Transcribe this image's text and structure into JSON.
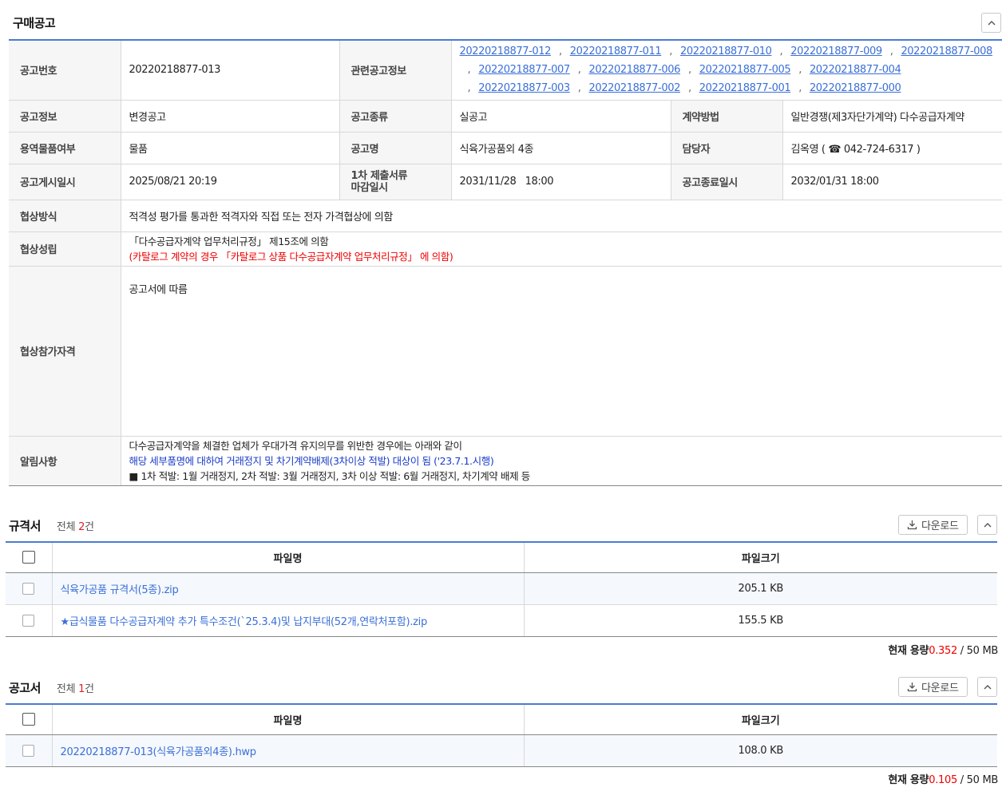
{
  "main": {
    "title": "구매공고",
    "rows": {
      "notice_no_label": "공고번호",
      "notice_no": "20220218877-013",
      "related_label": "관련공고정보",
      "related_links": [
        "20220218877-012",
        "20220218877-011",
        "20220218877-010",
        "20220218877-009",
        "20220218877-008",
        "20220218877-007",
        "20220218877-006",
        "20220218877-005",
        "20220218877-004",
        "20220218877-003",
        "20220218877-002",
        "20220218877-001",
        "20220218877-000"
      ],
      "related_sep": ",",
      "info_label": "공고정보",
      "info_value": "변경공고",
      "kind_label": "공고종류",
      "kind_value": "실공고",
      "contract_label": "계약방법",
      "contract_value": "일반경쟁(제3자단가계약) 다수공급자계약",
      "service_label": "용역물품여부",
      "service_value": "물품",
      "name_label": "공고명",
      "name_value": "식육가공품외 4종",
      "manager_label": "담당자",
      "manager_name": "김옥영 (",
      "manager_phone_icon": "☎",
      "manager_phone": " 042-724-6317 )",
      "posted_label": "공고게시일시",
      "posted_value": "2025/08/21 20:19",
      "deadline_label_1": "1차 제출서류",
      "deadline_label_2": "마감일시",
      "deadline_value": "2031/11/28   18:00",
      "end_label": "공고종료일시",
      "end_value": "2032/01/31 18:00",
      "nego_method_label": "협상방식",
      "nego_method_value": "적격성 평가를 통과한 적격자와 직접 또는 전자 가격협상에 의함",
      "nego_est_label": "협상성립",
      "nego_est_line1": "「다수공급자계약 업무처리규정」 제15조에 의함",
      "nego_est_line2": "(카탈로그 계약의 경우 「카탈로그 상품 다수공급자계약 업무처리규정」 에 의함)",
      "qual_label": "협상참가자격",
      "qual_value": "공고서에 따름",
      "notice_label": "알림사항",
      "notice_line1": "다수공급자계약을 체결한 업체가 우대가격 유지의무를 위반한 경우에는 아래와 같이",
      "notice_line2": "해당 세부품명에 대하여 거래정지 및 차기계약배제(3차이상 적발) 대상이 됨 ('23.7.1.시행)",
      "notice_line3": "■ 1차 적발: 1월 거래정지, 2차 적발: 3월 거래정지, 3차 이상 적발: 6월 거래정지, 차기계약 배제 등"
    }
  },
  "spec": {
    "title": "규격서",
    "count_prefix": "전체 ",
    "count": "2",
    "count_suffix": "건",
    "download_label": "다운로드",
    "col_name": "파일명",
    "col_size": "파일크기",
    "files": [
      {
        "name": "식육가공품 규격서(5종).zip",
        "size": "205.1 KB"
      },
      {
        "name": "★급식물품 다수공급자계약 추가 특수조건(`25.3.4)및 납지부대(52개,연락처포함).zip",
        "size": "155.5 KB"
      }
    ],
    "cap_label": "현재 용량",
    "cap_used": "0.352",
    "cap_total": " / 50 MB"
  },
  "notice_doc": {
    "title": "공고서",
    "count_prefix": "전체 ",
    "count": "1",
    "count_suffix": "건",
    "download_label": "다운로드",
    "col_name": "파일명",
    "col_size": "파일크기",
    "files": [
      {
        "name": "20220218877-013(식육가공품외4종).hwp",
        "size": "108.0 KB"
      }
    ],
    "cap_label": "현재 용량",
    "cap_used": "0.105",
    "cap_total": " / 50 MB"
  }
}
